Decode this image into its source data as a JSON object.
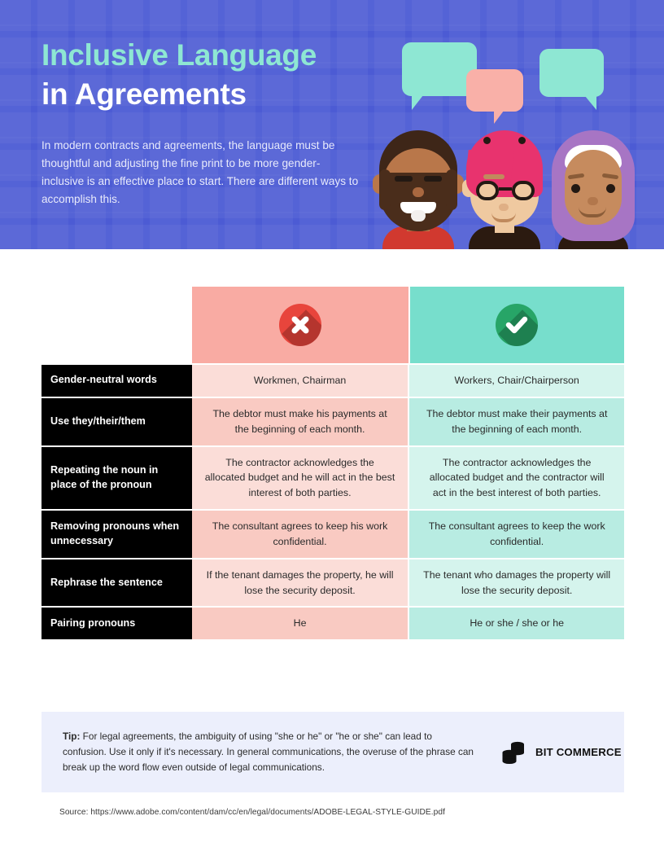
{
  "header": {
    "title_line1": "Inclusive Language",
    "title_line2": "in Agreements",
    "subtitle": "In modern contracts and agreements, the language must be thoughtful and adjusting the fine print to be more gender-inclusive is an effective place to start. There are different ways to accomplish this.",
    "colors": {
      "background": "#4C5BD4",
      "accent_teal": "#8EE7D3",
      "bubble_pink": "#F9B0A8"
    },
    "illustration": {
      "bubbles": [
        "speech-bubble-teal-left",
        "speech-bubble-pink-center",
        "speech-bubble-teal-right"
      ],
      "avatars": [
        "bearded-man-avatar",
        "person-with-glasses-avatar",
        "woman-with-hijab-avatar"
      ]
    }
  },
  "table": {
    "header": {
      "bad_icon": "cross-circle-icon",
      "good_icon": "check-circle-icon",
      "bad_color": "#F9ABA3",
      "good_color": "#77DECC"
    },
    "rows": [
      {
        "label": "Gender-neutral words",
        "bad": "Workmen, Chairman",
        "good": "Workers, Chair/Chairperson"
      },
      {
        "label": "Use they/their/them",
        "bad": "The debtor must make his payments at the beginning of each month.",
        "good": "The debtor must make their payments at the beginning of each month."
      },
      {
        "label": "Repeating the noun in place of the pronoun",
        "bad": "The contractor acknowledges the allocated budget and he will act in the best interest of both parties.",
        "good": "The contractor acknowledges the allocated budget and the contractor will act in the best interest of both parties."
      },
      {
        "label": "Removing pronouns when unnecessary",
        "bad": "The consultant agrees to keep his work confidential.",
        "good": "The consultant agrees to keep the work confidential."
      },
      {
        "label": "Rephrase the sentence",
        "bad": "If the tenant damages the property, he will lose the security deposit.",
        "good": "The tenant who damages the property will lose the security deposit."
      },
      {
        "label": "Pairing pronouns",
        "bad": "He",
        "good": "He or she / she or he"
      }
    ]
  },
  "tip": {
    "prefix": "Tip:",
    "body": " For legal agreements, the ambiguity of using \"she or he\" or \"he or she\" can lead to confusion. Use it only if it's necessary. In general communications, the overuse of the phrase can break up the word flow even outside of legal communications.",
    "background": "#ECEFFC"
  },
  "brand": {
    "name": "BIT COMMERCE",
    "logo": "stacked-coins-icon"
  },
  "source": {
    "text": "Source: https://www.adobe.com/content/dam/cc/en/legal/documents/ADOBE-LEGAL-STYLE-GUIDE.pdf"
  }
}
